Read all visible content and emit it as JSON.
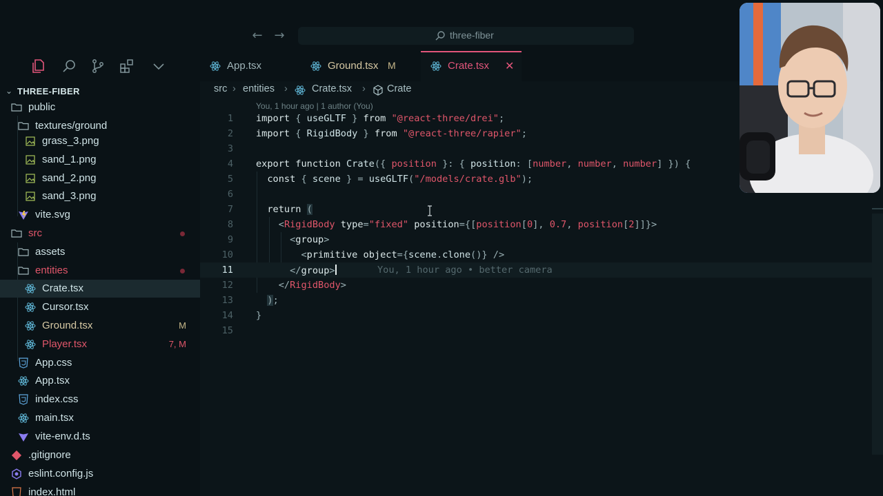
{
  "titlebar": {
    "back_icon": "arrow-left-icon",
    "forward_icon": "arrow-right-icon",
    "command_center_label": "three-fiber"
  },
  "activity_bar": {
    "icons": [
      "explorer-icon",
      "search-icon",
      "source-control-icon",
      "extensions-icon",
      "chevron-down-icon"
    ]
  },
  "sidebar": {
    "title": "THREE-FIBER",
    "items": [
      {
        "label": "public",
        "icon": "folder-icon"
      },
      {
        "label": "textures/ground",
        "icon": "folder-icon"
      },
      {
        "label": "grass_3.png",
        "icon": "image-file-icon"
      },
      {
        "label": "sand_1.png",
        "icon": "image-file-icon"
      },
      {
        "label": "sand_2.png",
        "icon": "image-file-icon"
      },
      {
        "label": "sand_3.png",
        "icon": "image-file-icon"
      },
      {
        "label": "vite.svg",
        "icon": "vite-icon"
      },
      {
        "label": "src",
        "icon": "folder-icon"
      },
      {
        "label": "assets",
        "icon": "folder-icon"
      },
      {
        "label": "entities",
        "icon": "folder-icon"
      },
      {
        "label": "Crate.tsx",
        "icon": "react-icon"
      },
      {
        "label": "Cursor.tsx",
        "icon": "react-icon"
      },
      {
        "label": "Ground.tsx",
        "icon": "react-icon",
        "badge": "M"
      },
      {
        "label": "Player.tsx",
        "icon": "react-icon",
        "badge": "7, M"
      },
      {
        "label": "App.css",
        "icon": "css-icon"
      },
      {
        "label": "App.tsx",
        "icon": "react-icon"
      },
      {
        "label": "index.css",
        "icon": "css-icon"
      },
      {
        "label": "main.tsx",
        "icon": "react-icon"
      },
      {
        "label": "vite-env.d.ts",
        "icon": "vite-icon"
      },
      {
        "label": ".gitignore",
        "icon": "git-icon"
      },
      {
        "label": "eslint.config.js",
        "icon": "eslint-icon"
      },
      {
        "label": "index.html",
        "icon": "html-icon"
      }
    ]
  },
  "tabs": [
    {
      "label": "App.tsx",
      "icon": "react-icon"
    },
    {
      "label": "Ground.tsx",
      "icon": "react-icon",
      "modified": "M"
    },
    {
      "label": "Crate.tsx",
      "icon": "react-icon",
      "active": true,
      "close_icon": "close-icon"
    }
  ],
  "breadcrumb": {
    "parts": [
      "src",
      "entities",
      "Crate.tsx",
      "Crate"
    ]
  },
  "code": {
    "blame_header": "You, 1 hour ago | 1 author (You)",
    "line_numbers": [
      "1",
      "2",
      "3",
      "4",
      "5",
      "6",
      "7",
      "8",
      "9",
      "10",
      "11",
      "12",
      "13",
      "14",
      "15"
    ],
    "inline_blame": "You, 1 hour ago • better camera"
  },
  "colors": {
    "accent": "#e2557a",
    "string": "#e0566a",
    "background": "#0c1519"
  }
}
